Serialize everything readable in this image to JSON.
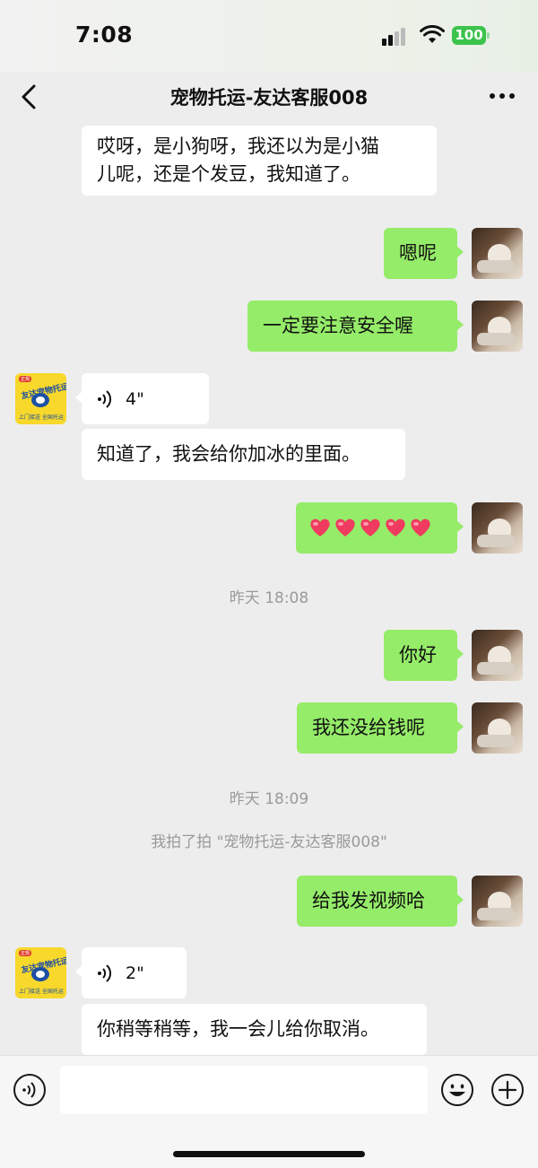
{
  "status_bar": {
    "time": "7:08",
    "battery": "100"
  },
  "header": {
    "title": "宠物托运-友达客服008"
  },
  "avatar_other": {
    "brand": "友达宠物托运",
    "subtitle": "上门接送  全国托运",
    "badge": "正规"
  },
  "messages": {
    "m1": "哎呀，是小狗呀，我还以为是小猫",
    "m1b": "儿呢，还是个发豆，我知道了。",
    "m2": "嗯呢",
    "m3": "一定要注意安全喔",
    "m4_voice": "4\"",
    "m5": "知道了，我会给你加冰的里面。",
    "m6_emoji": "❤️❤️❤️❤️❤️",
    "t1": "昨天 18:08",
    "m7": "你好",
    "m8": "我还没给钱呢",
    "t2": "昨天 18:09",
    "sys1": "我拍了拍 \"宠物托运-友达客服008\"",
    "m9": "给我发视频哈",
    "m10_voice": "2\"",
    "m11": "你稍等稍等，我一会儿给你取消。"
  },
  "colors": {
    "my_bubble": "#95ec69",
    "other_bubble": "#ffffff",
    "background": "#ededed",
    "battery": "#3cc34c"
  }
}
